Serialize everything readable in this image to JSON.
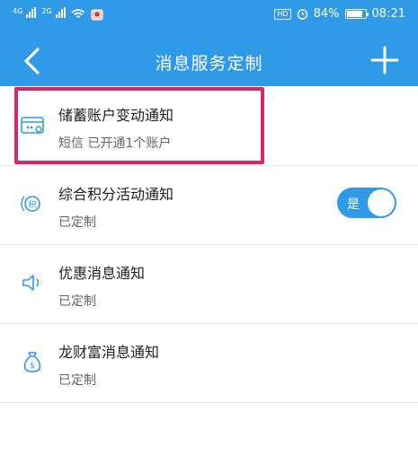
{
  "status_bar": {
    "net1": "4G",
    "net2": "2G",
    "hd": "HD",
    "battery": "84%",
    "time": "08:21",
    "battery_level": 0.84
  },
  "header": {
    "title": "消息服务定制"
  },
  "items": [
    {
      "name": "储蓄账户变动通知",
      "sub": "短信 已开通1个账户",
      "icon": "card-icon"
    },
    {
      "name": "综合积分活动通知",
      "sub": "已定制",
      "icon": "points-icon",
      "toggle_label": "是"
    },
    {
      "name": "优惠消息通知",
      "sub": "已定制",
      "icon": "speaker-icon"
    },
    {
      "name": "龙财富消息通知",
      "sub": "已定制",
      "icon": "money-bag-icon"
    }
  ],
  "colors": {
    "primary": "#2f9be8",
    "highlight": "#d6266f"
  }
}
